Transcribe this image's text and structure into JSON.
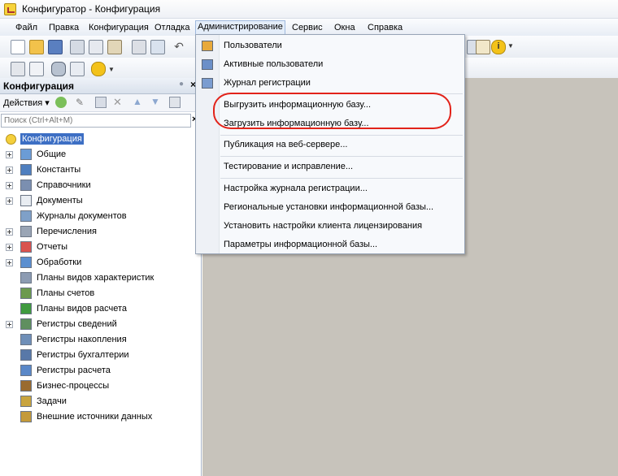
{
  "window": {
    "title": "Конфигуратор - Конфигурация"
  },
  "menubar": {
    "items": [
      "Файл",
      "Правка",
      "Конфигурация",
      "Отладка",
      "Администрирование",
      "Сервис",
      "Окна",
      "Справка"
    ],
    "active": "Администрирование"
  },
  "panel": {
    "title": "Конфигурация",
    "actions_label": "Действия",
    "search_placeholder": "Поиск (Ctrl+Alt+M)"
  },
  "tree": {
    "root": "Конфигурация",
    "items": [
      "Общие",
      "Константы",
      "Справочники",
      "Документы",
      "Журналы документов",
      "Перечисления",
      "Отчеты",
      "Обработки",
      "Планы видов характеристик",
      "Планы счетов",
      "Планы видов расчета",
      "Регистры сведений",
      "Регистры накопления",
      "Регистры бухгалтерии",
      "Регистры расчета",
      "Бизнес-процессы",
      "Задачи",
      "Внешние источники данных"
    ]
  },
  "admin_menu": {
    "items": [
      "Пользователи",
      "Активные пользователи",
      "Журнал регистрации",
      "Выгрузить информационную базу...",
      "Загрузить информационную базу...",
      "Публикация на веб-сервере...",
      "Тестирование и исправление...",
      "Настройка журнала регистрации...",
      "Региональные установки информационной базы...",
      "Установить настройки клиента лицензирования",
      "Параметры информационной базы..."
    ]
  },
  "colors": {
    "highlight": "#e2231a",
    "workspace": "#c7c3bb",
    "root_selection": "#3d6fc4"
  }
}
